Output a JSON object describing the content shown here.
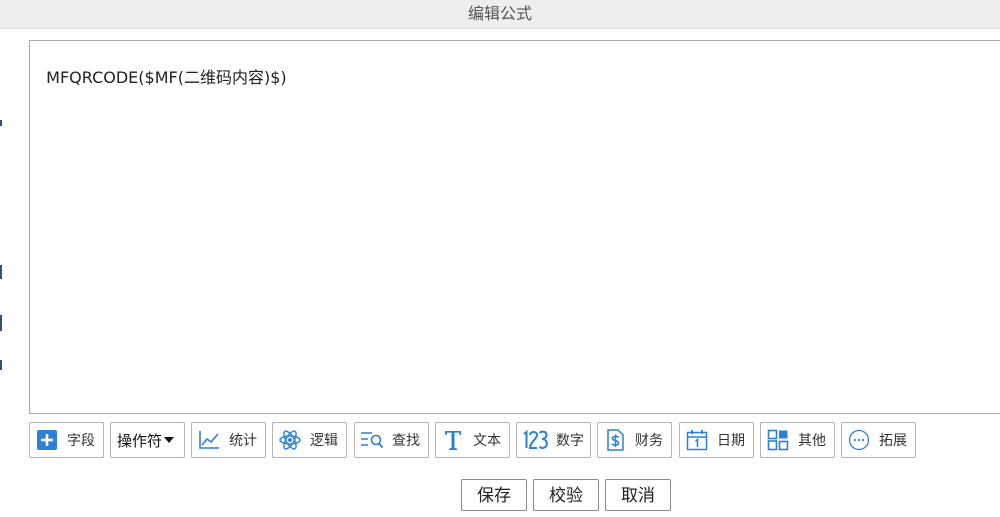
{
  "dialog": {
    "title": "编辑公式"
  },
  "editor": {
    "formula": "MFQRCODE($MF(二维码内容)$)"
  },
  "toolbar": {
    "items": [
      {
        "label": "字段",
        "icon": "add-icon"
      },
      {
        "label": "操作符",
        "icon": "caret-down-icon"
      },
      {
        "label": "统计",
        "icon": "line-chart-icon"
      },
      {
        "label": "逻辑",
        "icon": "atom-icon"
      },
      {
        "label": "查找",
        "icon": "search-list-icon"
      },
      {
        "label": "文本",
        "icon": "text-t-icon"
      },
      {
        "label": "数字",
        "icon": "number-123-icon"
      },
      {
        "label": "财务",
        "icon": "dollar-doc-icon"
      },
      {
        "label": "日期",
        "icon": "calendar-icon"
      },
      {
        "label": "其他",
        "icon": "grid-icon"
      },
      {
        "label": "拓展",
        "icon": "more-circle-icon"
      }
    ]
  },
  "actions": {
    "save": "保存",
    "verify": "校验",
    "cancel": "取消"
  },
  "colors": {
    "icon_blue": "#2e7fd6",
    "title_bar": "#eeeeee",
    "border": "#b5b5b5"
  }
}
